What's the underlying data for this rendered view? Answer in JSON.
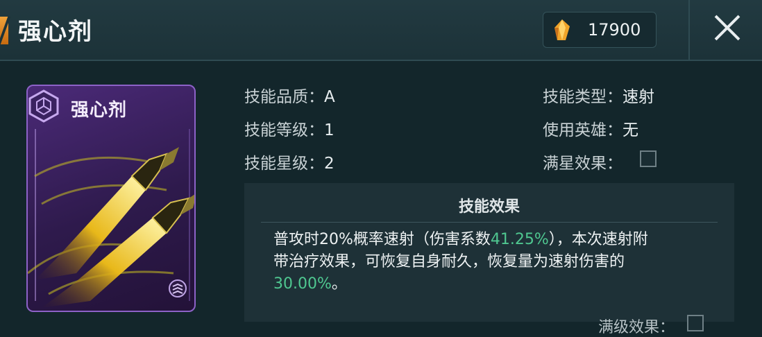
{
  "header": {
    "title": "强心剂",
    "currency_value": "17900",
    "gem_icon": "crystal-gem-icon",
    "close_icon": "close-icon"
  },
  "card": {
    "title": "强心剂",
    "class_icon": "hexagon-emblem-icon",
    "art": "twin-bullet-art",
    "corner_icon": "rank-chevron-icon",
    "colors": {
      "frame": "#8d62c8",
      "bullet": "#f4d020"
    }
  },
  "info": {
    "quality_label": "技能品质：",
    "quality_value": "A",
    "level_label": "技能等级：",
    "level_value": "1",
    "star_label": "技能星级：",
    "star_value": "2",
    "type_label": "技能类型：",
    "type_value": "速射",
    "hero_label": "使用英雄：",
    "hero_value": "无",
    "maxstar_label": "满星效果："
  },
  "effect": {
    "title": "技能效果",
    "line1_a": "普攻时20%概率速射（伤害系数",
    "line1_b": "41.25%",
    "line1_c": "），本次速射附",
    "line2": "带治疗效果，可恢复自身耐久，恢复量为速射伤害的",
    "line3_a": "30.00%",
    "line3_b": "。",
    "max_level_label": "满级效果：",
    "accent_color": "#4fc790"
  }
}
